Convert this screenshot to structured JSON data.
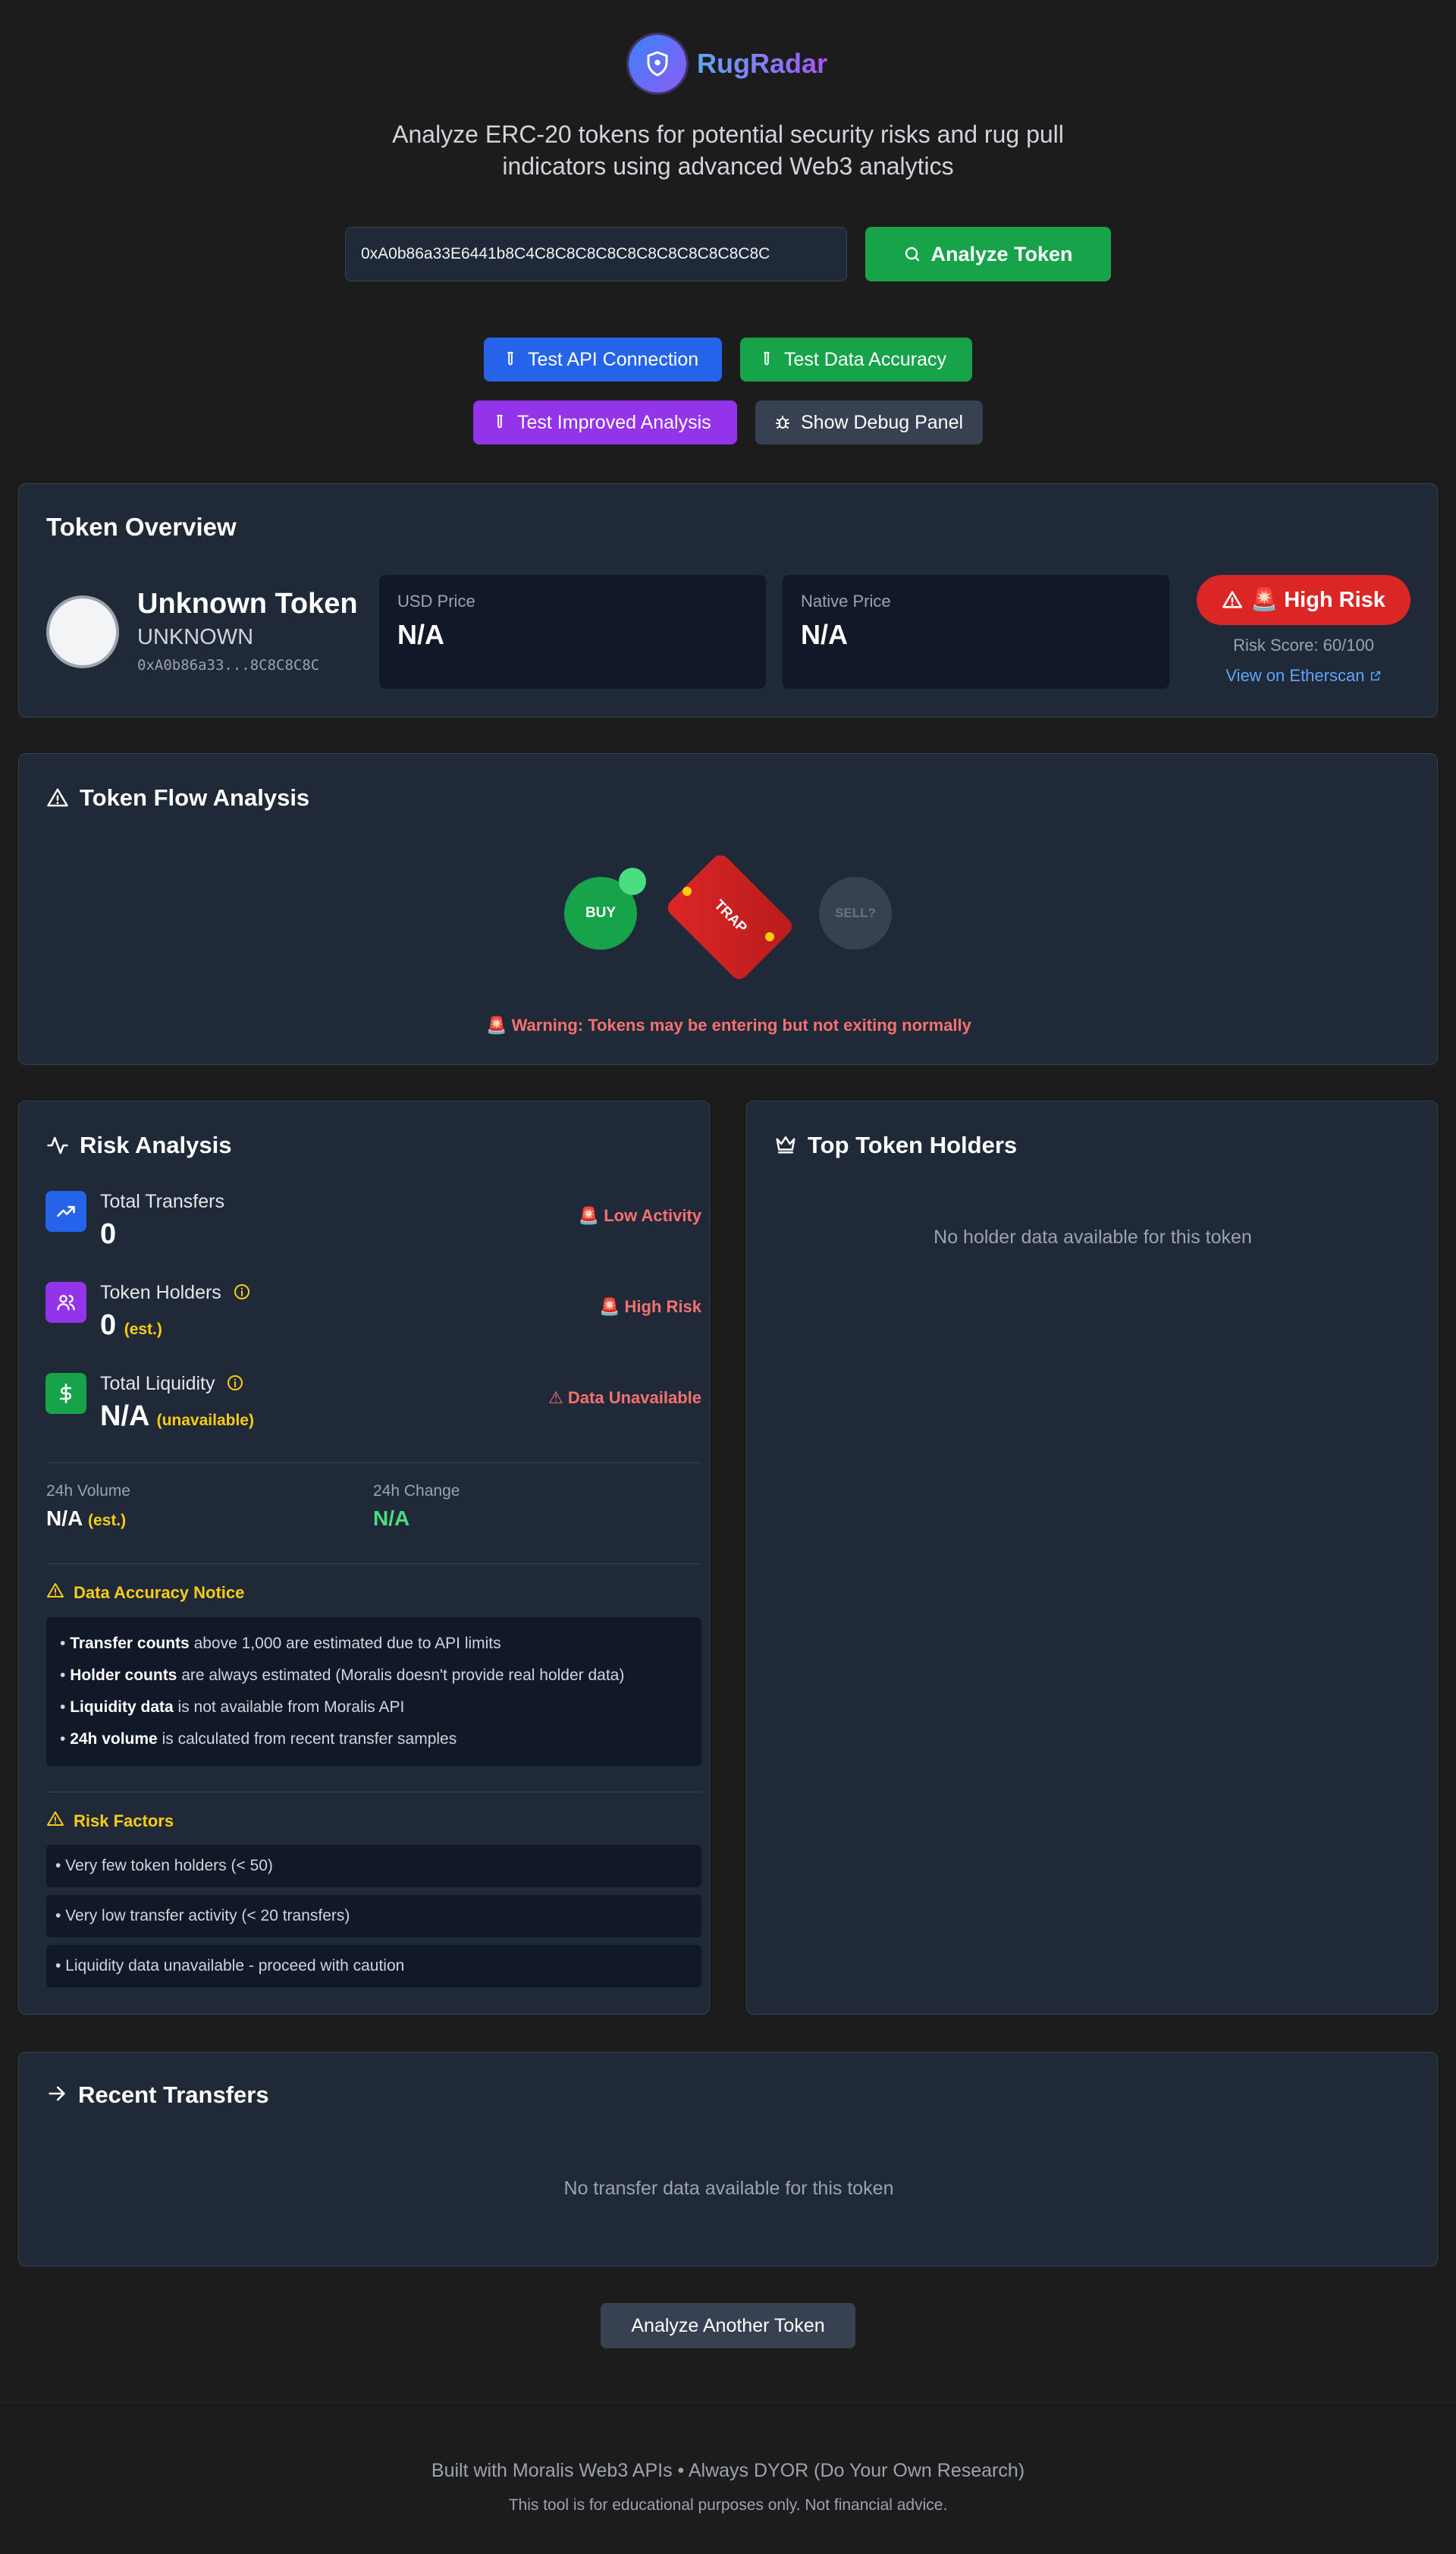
{
  "app": {
    "name": "RugRadar",
    "tagline": "Analyze ERC-20 tokens for potential security risks and rug pull indicators using advanced Web3 analytics",
    "accent_blue": "#3b82f6",
    "accent_purple": "#a855f7"
  },
  "search": {
    "value": "0xA0b86a33E6441b8C4C8C8C8C8C8C8C8C8C8C8C8C",
    "analyze_label": "Analyze Token"
  },
  "test_buttons": {
    "api_label": "Test API Connection",
    "accuracy_label": "Test Data Accuracy",
    "improved_label": "Test Improved Analysis",
    "debug_label": "Show Debug Panel"
  },
  "overview": {
    "title": "Token Overview",
    "token_name": "Unknown Token",
    "token_symbol": "UNKNOWN",
    "token_address": "0xA0b86a33...8C8C8C8C",
    "usd_price_label": "USD Price",
    "usd_price_value": "N/A",
    "native_price_label": "Native Price",
    "native_price_value": "N/A",
    "risk_badge": "🚨 High Risk",
    "risk_score": "Risk Score: 60/100",
    "etherscan_link": "View on Etherscan"
  },
  "flow": {
    "title": "Token Flow Analysis",
    "buy_label": "BUY",
    "trap_label": "TRAP",
    "sell_label": "SELL?",
    "warning": "🚨 Warning: Tokens may be entering but not exiting normally"
  },
  "risk": {
    "title": "Risk Analysis",
    "transfers_label": "Total Transfers",
    "transfers_value": "0",
    "transfers_status": "🚨 Low Activity",
    "holders_label": "Token Holders",
    "holders_value": "0",
    "holders_est": "(est.)",
    "holders_status": "🚨 High Risk",
    "liquidity_label": "Total Liquidity",
    "liquidity_value": "N/A",
    "liquidity_note": "(unavailable)",
    "liquidity_status": "⚠ Data Unavailable",
    "volume_label": "24h Volume",
    "volume_value": "N/A",
    "volume_est": "(est.)",
    "change_label": "24h Change",
    "change_value": "N/A",
    "notice_title": "Data Accuracy Notice",
    "notice_items": [
      {
        "bold": "Transfer counts",
        "rest": " above 1,000 are estimated due to API limits"
      },
      {
        "bold": "Holder counts",
        "rest": " are always estimated (Moralis doesn't provide real holder data)"
      },
      {
        "bold": "Liquidity data",
        "rest": " is not available from Moralis API"
      },
      {
        "bold": "24h volume",
        "rest": " is calculated from recent transfer samples"
      }
    ],
    "factors_title": "Risk Factors",
    "factors": [
      "• Very few token holders (< 50)",
      "• Very low transfer activity (< 20 transfers)",
      "• Liquidity data unavailable - proceed with caution"
    ]
  },
  "holders": {
    "title": "Top Token Holders",
    "empty": "No holder data available for this token"
  },
  "transfers": {
    "title": "Recent Transfers",
    "empty": "No transfer data available for this token"
  },
  "analyze_another": "Analyze Another Token",
  "footer": {
    "line1": "Built with Moralis Web3 APIs • Always DYOR (Do Your Own Research)",
    "line2": "This tool is for educational purposes only. Not financial advice."
  }
}
